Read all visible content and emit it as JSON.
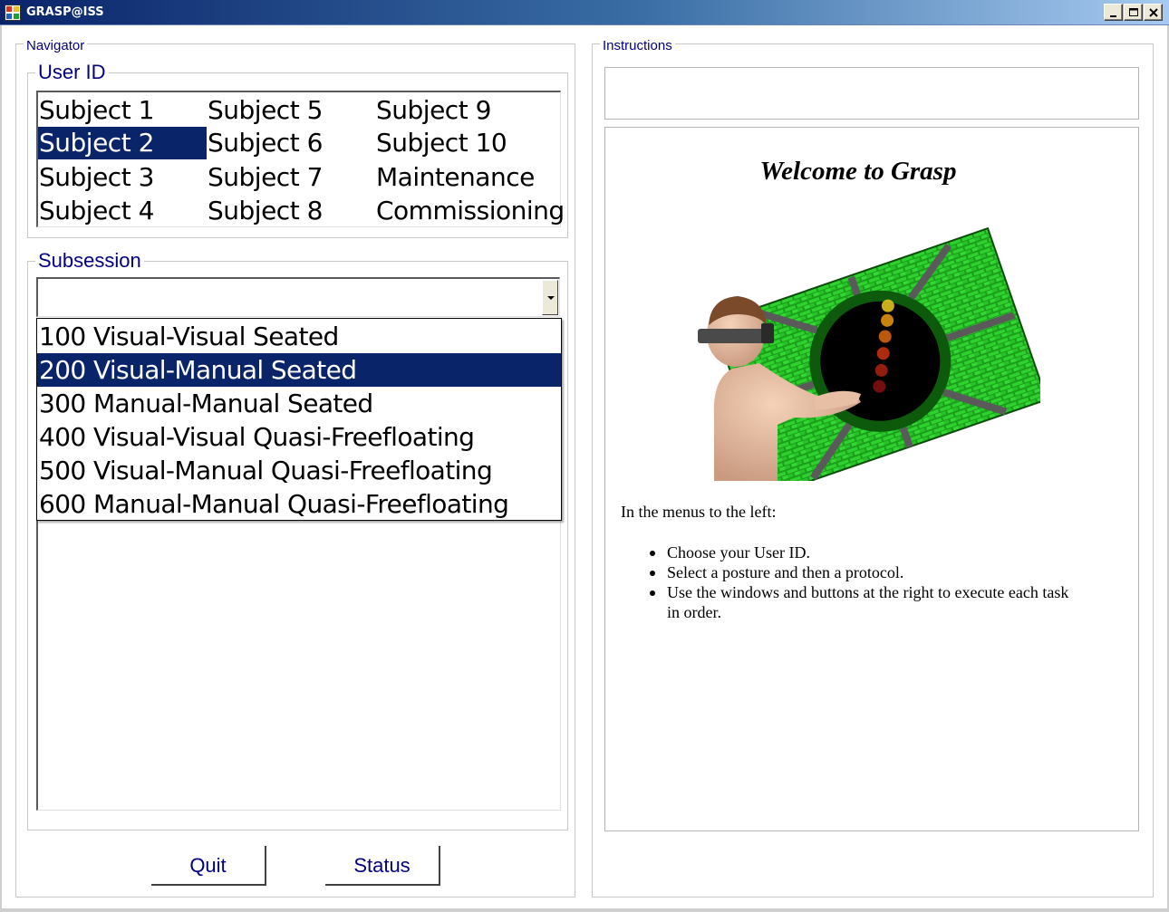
{
  "window": {
    "title": "GRASP@ISS",
    "controls": [
      "minimize-icon",
      "maximize-icon",
      "close-icon"
    ]
  },
  "navigator": {
    "label": "Navigator",
    "user_id": {
      "label": "User ID",
      "items": [
        "Subject 1",
        "Subject 2",
        "Subject 3",
        "Subject 4",
        "Subject 5",
        "Subject 6",
        "Subject 7",
        "Subject 8",
        "Subject 9",
        "Subject 10",
        "Maintenance",
        "Commissioning"
      ],
      "selected": "Subject 2"
    },
    "subsession": {
      "label": "Subsession",
      "value": "",
      "options": [
        "100 Visual-Visual Seated",
        "200 Visual-Manual Seated",
        "300 Manual-Manual Seated",
        "400 Visual-Visual Quasi-Freefloating",
        "500 Visual-Manual Quasi-Freefloating",
        "600 Manual-Manual Quasi-Freefloating"
      ],
      "highlighted": "200 Visual-Manual Seated"
    },
    "buttons": {
      "quit": "Quit",
      "status": "Status"
    }
  },
  "instructions": {
    "label": "Instructions",
    "welcome": "Welcome to Grasp",
    "intro": "In the menus to the left:",
    "steps": [
      "Choose your User ID.",
      "Select a posture and then a protocol.",
      "Use the windows and buttons at the right to execute each task in order."
    ]
  },
  "colors": {
    "selection": "#0a246a",
    "label_text": "#000080",
    "tunnel_green": "#1fb51f"
  }
}
